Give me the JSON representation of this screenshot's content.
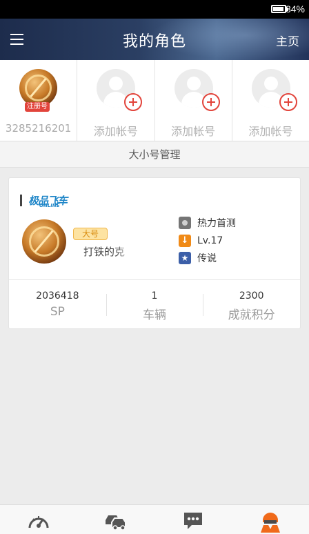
{
  "status_bar": {
    "battery_text": "84%",
    "battery_level": 0.84
  },
  "header": {
    "title": "我的角色",
    "home_label": "主页",
    "menu_icon": "hamburger-menu-icon"
  },
  "accounts": [
    {
      "label": "3285216201",
      "badge": "注册号",
      "type": "registered"
    },
    {
      "label": "添加帐号",
      "type": "add"
    },
    {
      "label": "添加帐号",
      "type": "add"
    },
    {
      "label": "添加帐号",
      "type": "add"
    }
  ],
  "manage_label": "大小号管理",
  "game_card": {
    "logo_text": "极品飞车",
    "logo_sub": "ONLINE",
    "role_badge": "大号",
    "role_name": "打铁的克",
    "attributes": [
      {
        "icon": "server-icon",
        "text": "热力首测"
      },
      {
        "icon": "level-icon",
        "text": "Lv.17"
      },
      {
        "icon": "rank-star-icon",
        "text": "传说"
      }
    ],
    "stats": [
      {
        "value": "2036418",
        "label": "SP"
      },
      {
        "value": "1",
        "label": "车辆"
      },
      {
        "value": "2300",
        "label": "成就积分"
      }
    ]
  },
  "bottom_nav": [
    {
      "icon": "speedometer-icon",
      "color": "#555555"
    },
    {
      "icon": "cars-icon",
      "color": "#555555"
    },
    {
      "icon": "chat-bubble-icon",
      "color": "#555555"
    },
    {
      "icon": "racer-profile-icon",
      "color": "#f06a1a",
      "active": true
    }
  ],
  "colors": {
    "accent": "#f06a1a",
    "badge_red": "#e2443b",
    "header_dark": "#1d2c4c"
  }
}
